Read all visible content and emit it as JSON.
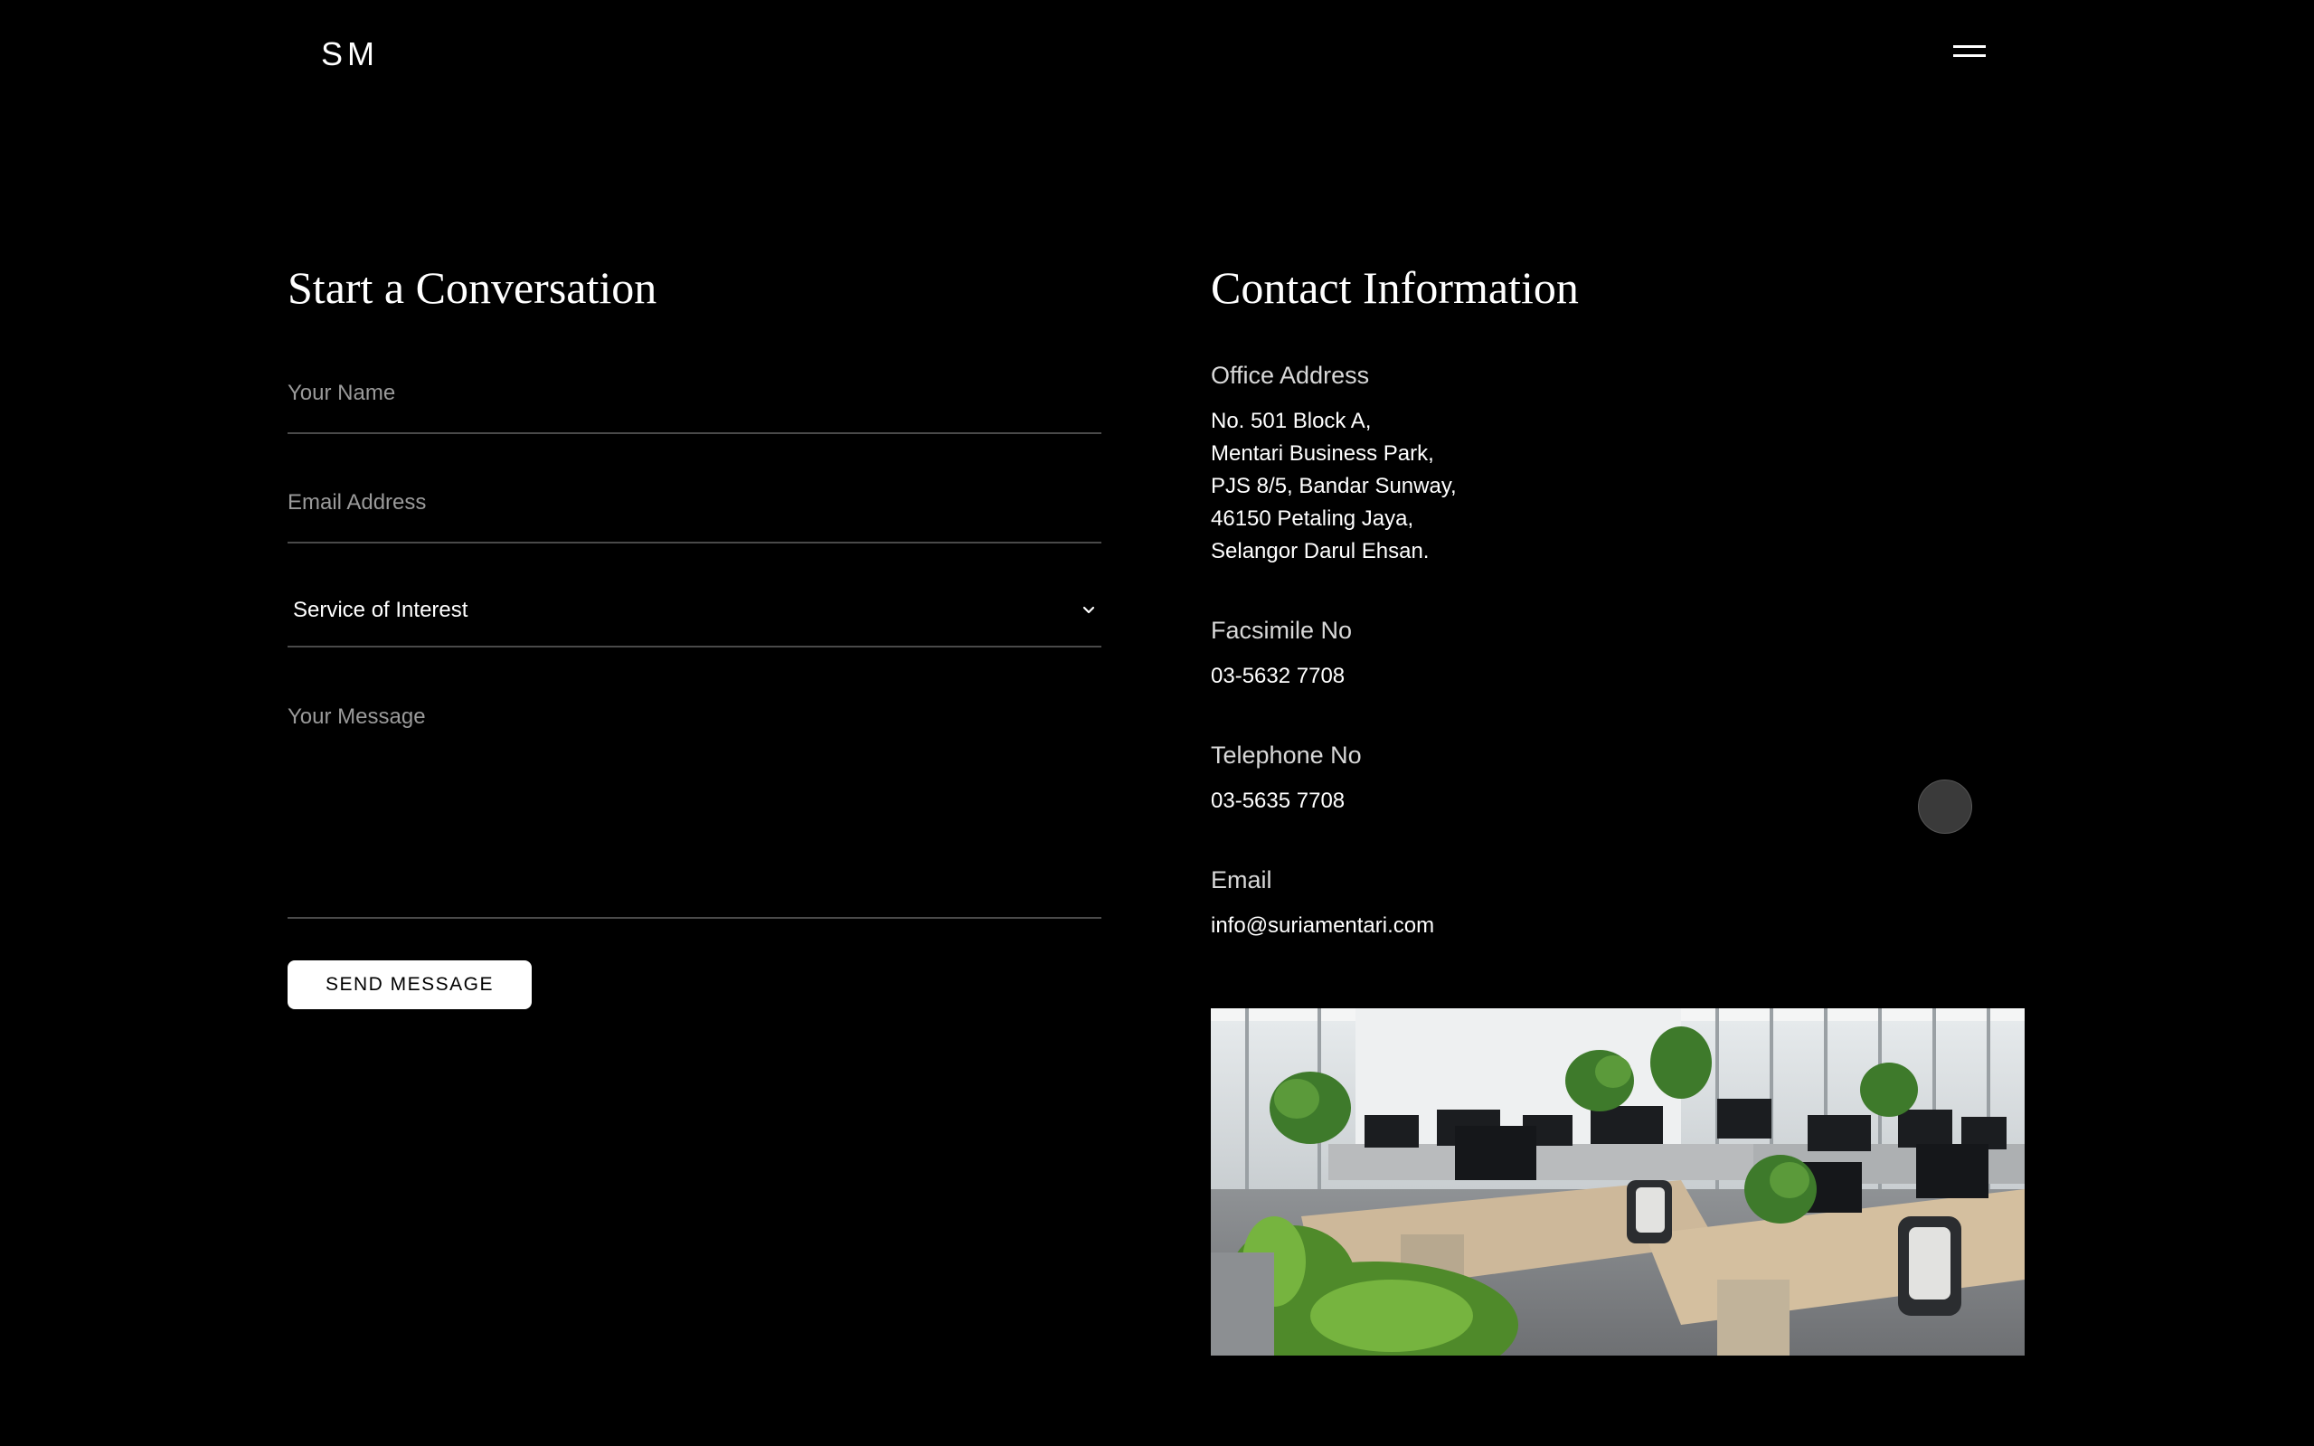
{
  "brand": {
    "logo_text": "SM"
  },
  "nav": {
    "menu_icon": "hamburger-menu-icon"
  },
  "form": {
    "title": "Start a Conversation",
    "name_placeholder": "Your Name",
    "email_placeholder": "Email Address",
    "service_label": "Service of Interest",
    "message_placeholder": "Your Message",
    "submit_label": "SEND MESSAGE"
  },
  "contact": {
    "title": "Contact Information",
    "address_label": "Office Address",
    "address_lines": [
      "No. 501 Block A,",
      "Mentari Business Park,",
      "PJS 8/5, Bandar Sunway,",
      "46150 Petaling Jaya,",
      "Selangor Darul Ehsan."
    ],
    "fax_label": "Facsimile No",
    "fax_value": "03-5632 7708",
    "tel_label": "Telephone No",
    "tel_value": "03-5635 7708",
    "email_label": "Email",
    "email_value": "info@suriamentari.com"
  },
  "colors": {
    "background": "#000000",
    "text": "#ffffff",
    "muted": "#9a9a9a",
    "divider": "#4a4a4a",
    "button_bg": "#ffffff",
    "button_text": "#000000"
  }
}
